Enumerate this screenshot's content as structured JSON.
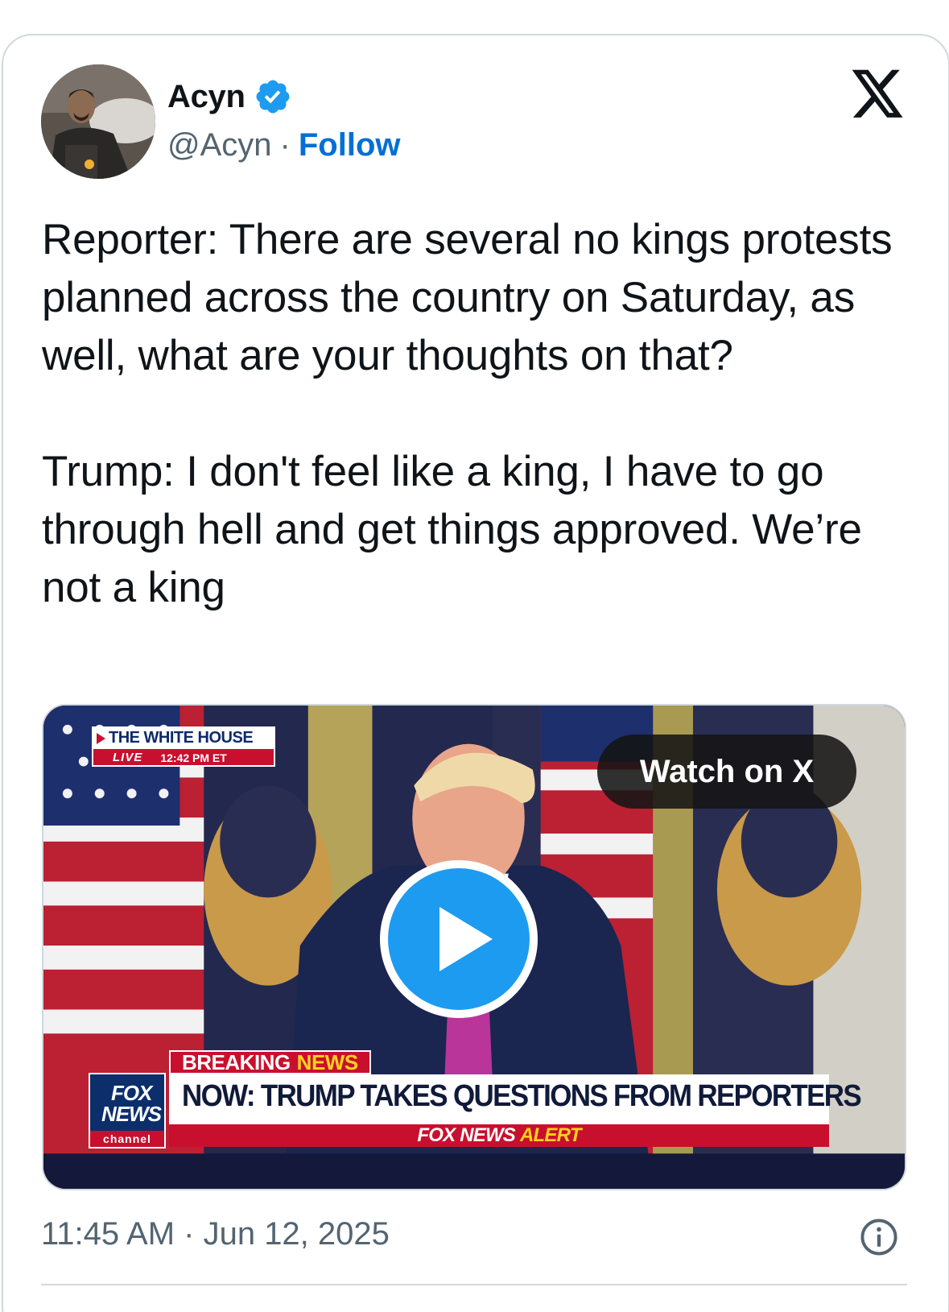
{
  "author": {
    "display_name": "Acyn",
    "handle": "@Acyn",
    "separator": "·",
    "follow_label": "Follow",
    "verified_icon": "verified-badge-icon",
    "verified_color": "#1d9bf0"
  },
  "platform_logo": "x-logo-icon",
  "tweet": {
    "text": "Reporter: There are several no kings protests planned across the country on Saturday, as well, what are your thoughts on that?\n\nTrump: I don't feel like a king, I have to go through hell and get things approved. We’re not a king"
  },
  "media": {
    "watch_label": "Watch on X",
    "play_icon": "play-icon",
    "broadcast": {
      "location": "THE WHITE HOUSE",
      "live": "LIVE",
      "time": "12:42 PM ET",
      "breaking_1": "BREAKING",
      "breaking_2": "NEWS",
      "headline": "NOW: TRUMP TAKES QUESTIONS FROM REPORTERS",
      "alert_1": "FOX NEWS",
      "alert_2": "ALERT",
      "logo_line1": "FOX",
      "logo_line2": "NEWS",
      "logo_line3": "channel"
    }
  },
  "footer": {
    "timestamp": "11:45 AM · Jun 12, 2025",
    "info_icon": "info-icon"
  },
  "colors": {
    "link_blue": "#006fd6",
    "secondary_text": "#536471",
    "border": "#cfd9de",
    "play_blue": "#1d9bf0"
  }
}
